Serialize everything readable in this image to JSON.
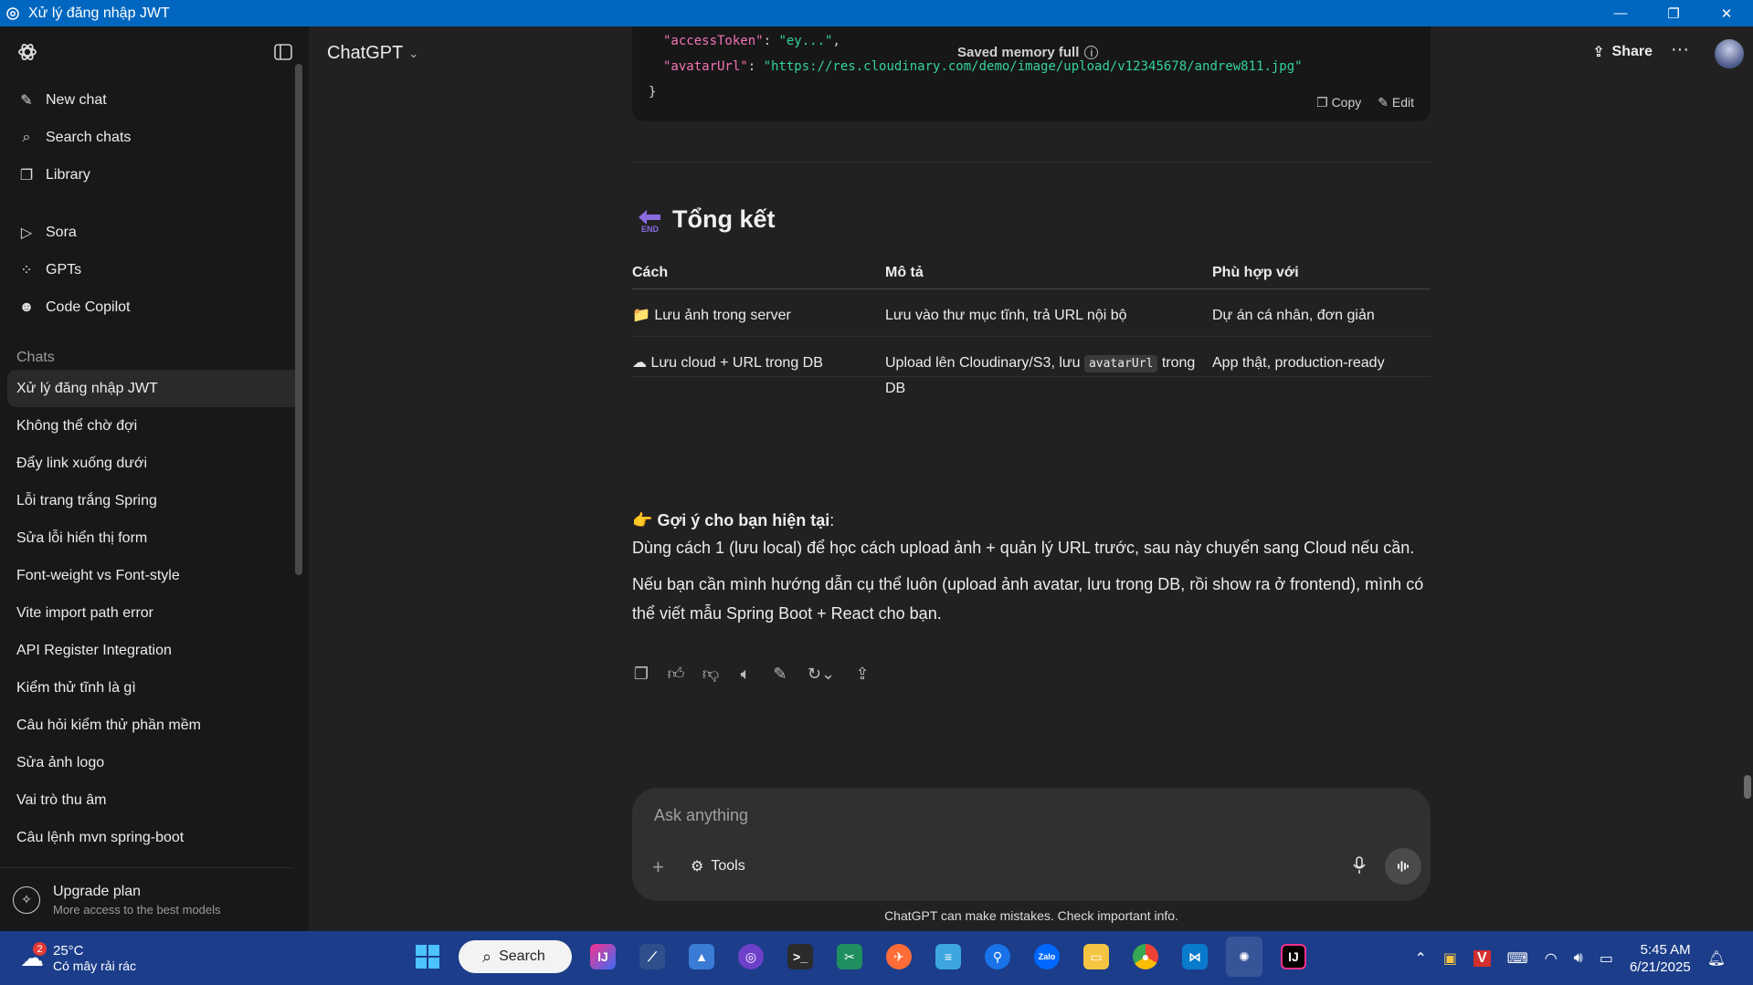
{
  "window": {
    "title": "Xử lý đăng nhập JWT",
    "minimize": "—",
    "restore": "❐",
    "close": "✕"
  },
  "sidebar": {
    "nav": [
      {
        "label": "New chat",
        "icon": "edit-icon",
        "glyph": "✎"
      },
      {
        "label": "Search chats",
        "icon": "search-icon",
        "glyph": "⌕"
      },
      {
        "label": "Library",
        "icon": "library-icon",
        "glyph": "❐"
      }
    ],
    "nav2": [
      {
        "label": "Sora",
        "icon": "play-icon",
        "glyph": "▷"
      },
      {
        "label": "GPTs",
        "icon": "grid-icon",
        "glyph": "⁘"
      },
      {
        "label": "Code Copilot",
        "icon": "copilot-icon",
        "glyph": "☻"
      }
    ],
    "section_label": "Chats",
    "chats": [
      "Xử lý đăng nhập JWT",
      "Không thể chờ đợi",
      "Đẩy link xuống dưới",
      "Lỗi trang trắng Spring",
      "Sửa lỗi hiển thị form",
      "Font-weight vs Font-style",
      "Vite import path error",
      "API Register Integration",
      "Kiểm thử tĩnh là gì",
      "Câu hỏi kiểm thử phần mềm",
      "Sửa ảnh logo",
      "Vai trò thu âm",
      "Câu lệnh mvn spring-boot"
    ],
    "upgrade": {
      "title": "Upgrade plan",
      "subtitle": "More access to the best models"
    }
  },
  "header": {
    "title": "ChatGPT",
    "memory": "Saved memory full",
    "share": "Share",
    "more": "···"
  },
  "code": {
    "line1_key": "\"accessToken\"",
    "line1_val": "\"ey...\"",
    "line2_key": "\"avatarUrl\"",
    "line2_val": "\"https://res.cloudinary.com/demo/image/upload/v12345678/andrew811.jpg\"",
    "colon": ": ",
    "comma": ",",
    "close": "}",
    "copy": "Copy",
    "edit": "Edit"
  },
  "summary": {
    "title": "Tổng kết",
    "headers": [
      "Cách",
      "Mô tả",
      "Phù hợp với"
    ],
    "rows": [
      {
        "icon": "📁",
        "method": "Lưu ảnh trong server",
        "desc": "Lưu vào thư mục tĩnh, trả URL nội bộ",
        "fit": "Dự án cá nhân, đơn giản"
      },
      {
        "icon": "☁",
        "method": "Lưu cloud + URL trong DB",
        "desc_pre": "Upload lên Cloudinary/S3, lưu ",
        "desc_code": "avatarUrl",
        "desc_post": " trong DB",
        "fit": "App thật, production-ready"
      }
    ]
  },
  "suggestion": {
    "emoji": "👉",
    "heading": "Gợi ý cho bạn hiện tại",
    "colon": ":",
    "line1": "Dùng cách 1 (lưu local) để học cách upload ảnh + quản lý URL trước, sau này chuyển sang Cloud nếu cần.",
    "line2": "Nếu bạn cần mình hướng dẫn cụ thể luôn (upload ảnh avatar, lưu trong DB, rồi show ra ở frontend), mình có thể viết mẫu Spring Boot + React cho bạn."
  },
  "composer": {
    "placeholder": "Ask anything",
    "tools": "Tools"
  },
  "disclaimer": "ChatGPT can make mistakes. Check important info.",
  "taskbar": {
    "temp": "25°C",
    "weather": "Có mây rải rác",
    "weather_badge": "2",
    "search": "Search",
    "time": "5:45 AM",
    "date": "6/21/2025"
  }
}
